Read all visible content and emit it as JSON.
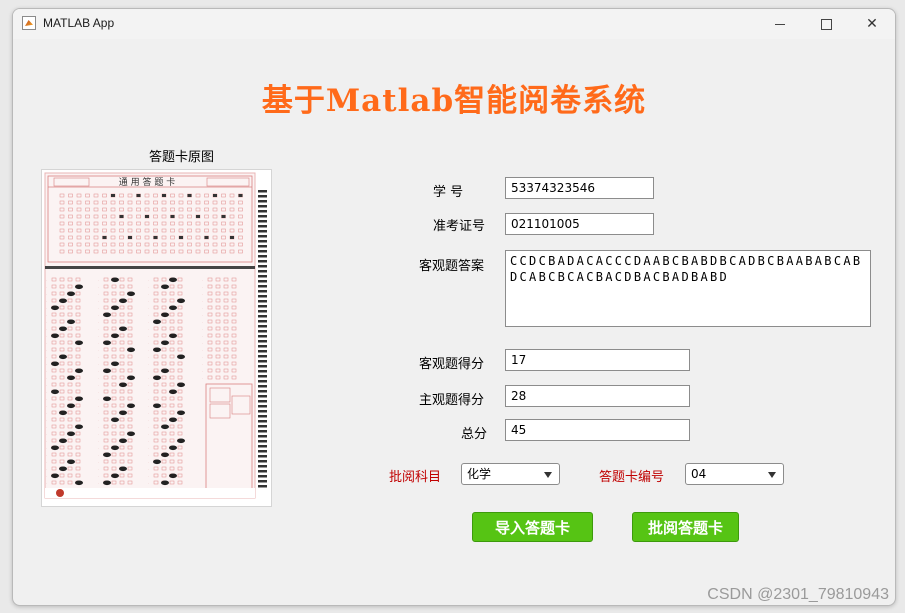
{
  "window": {
    "title": "MATLAB App"
  },
  "app": {
    "title": "基于Matlab智能阅卷系统"
  },
  "image": {
    "caption": "答题卡原图",
    "sheet_heading": "通 用 答 题 卡"
  },
  "form": {
    "student_id_label": "学    号",
    "student_id_value": "53374323546",
    "exam_no_label": "准考证号",
    "exam_no_value": "021101005",
    "objective_answers_label": "客观题答案",
    "objective_answers_value": "CCDCBADACACCCDAABCBABDBCADBCBAABABCABDCABCBCACBACDBACBADBABD",
    "objective_score_label": "客观题得分",
    "objective_score_value": "17",
    "subjective_score_label": "主观题得分",
    "subjective_score_value": "28",
    "total_label": "总分",
    "total_value": "45",
    "subject_label": "批阅科目",
    "subject_value": "化学",
    "card_no_label": "答题卡编号",
    "card_no_value": "04"
  },
  "buttons": {
    "import_label": "导入答题卡",
    "grade_label": "批阅答题卡"
  },
  "watermark": "CSDN @2301_79810943",
  "colors": {
    "title": "#ff6a1a",
    "label_red": "#c00000",
    "button_green": "#56c414"
  }
}
